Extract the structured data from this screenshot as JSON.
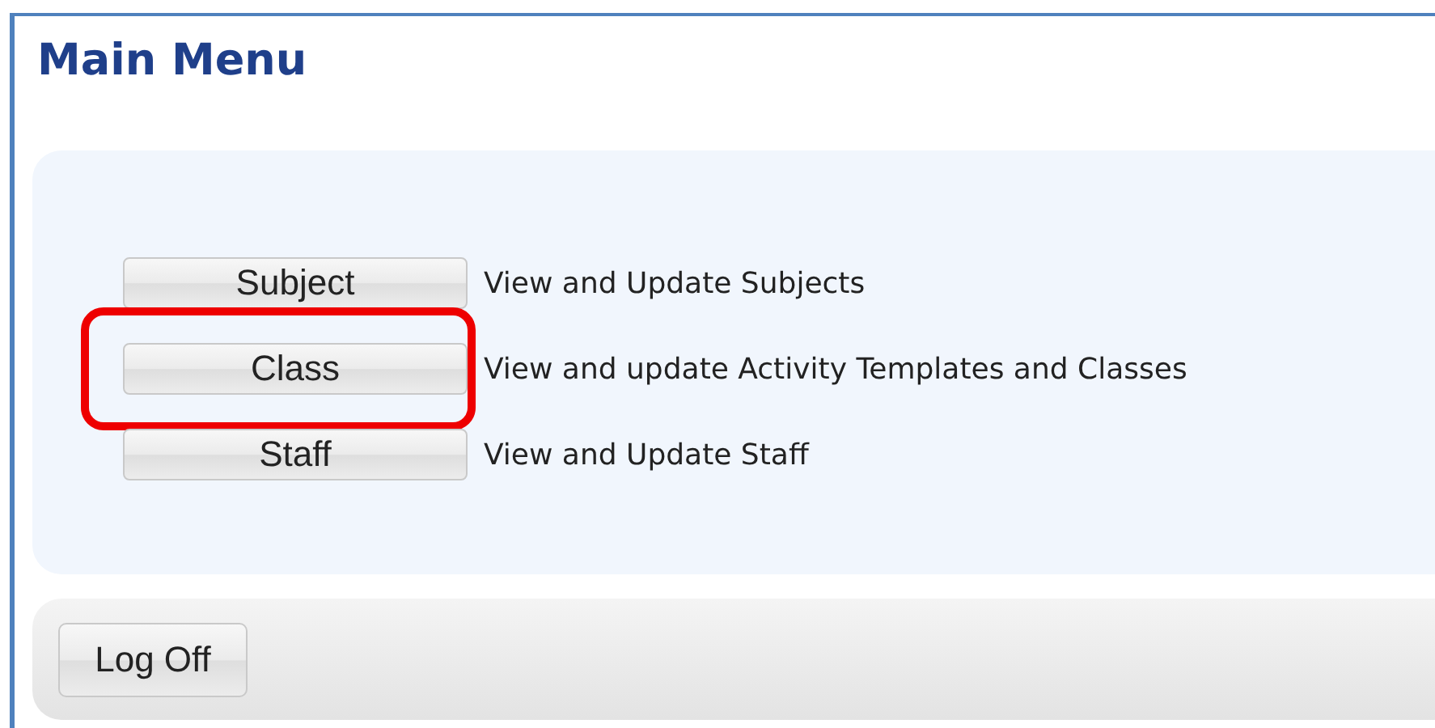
{
  "title": "Main Menu",
  "menu_items": [
    {
      "label": "Subject",
      "description": "View and Update Subjects",
      "highlighted": false
    },
    {
      "label": "Class",
      "description": "View and update Activity Templates and Classes",
      "highlighted": true
    },
    {
      "label": "Staff",
      "description": "View and Update Staff",
      "highlighted": false
    }
  ],
  "footer": {
    "button": "Log Off"
  }
}
